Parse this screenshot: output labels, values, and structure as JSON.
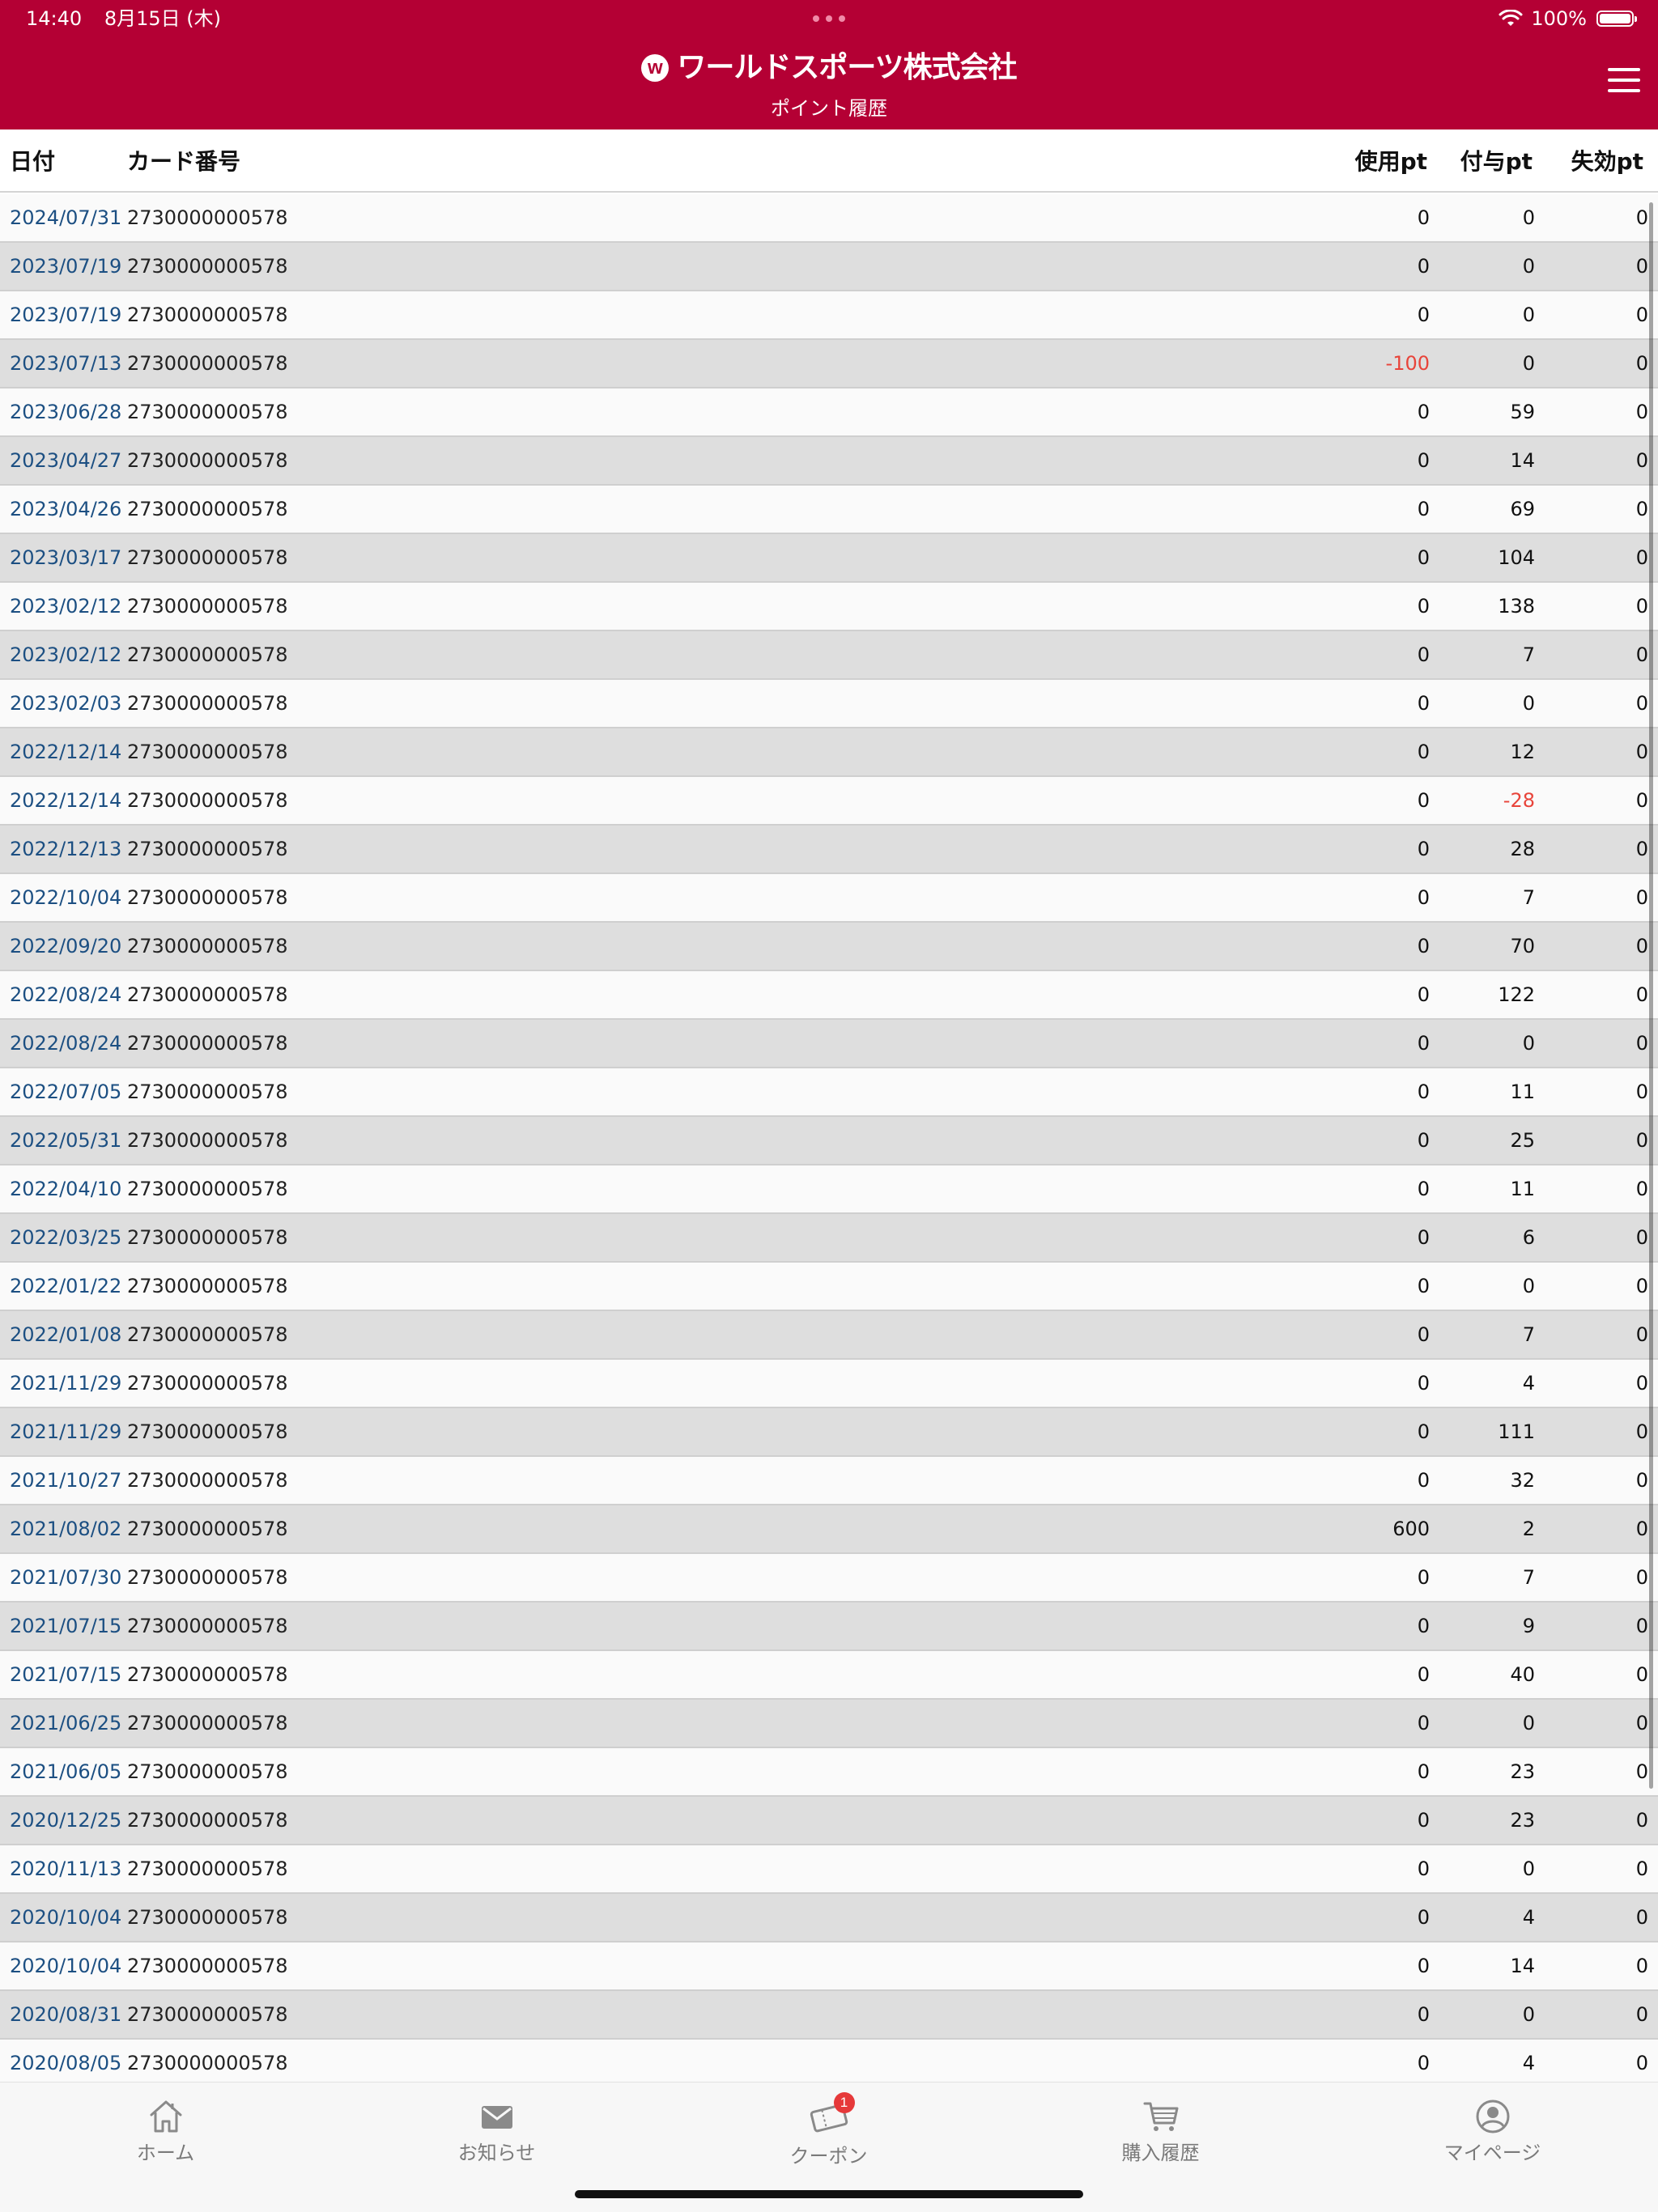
{
  "status_bar": {
    "time": "14:40",
    "date": "8月15日 (木)",
    "battery": "100%"
  },
  "header": {
    "brand_mark": "w",
    "brand_name": "ワールドスポーツ株式会社",
    "page_title": "ポイント履歴"
  },
  "table": {
    "columns": {
      "date": "日付",
      "card": "カード番号",
      "used": "使用pt",
      "given": "付与pt",
      "expired": "失効pt"
    },
    "rows": [
      {
        "date": "2024/07/31",
        "card": "2730000000578",
        "used": "0",
        "given": "0",
        "expired": "0"
      },
      {
        "date": "2023/07/19",
        "card": "2730000000578",
        "used": "0",
        "given": "0",
        "expired": "0"
      },
      {
        "date": "2023/07/19",
        "card": "2730000000578",
        "used": "0",
        "given": "0",
        "expired": "0"
      },
      {
        "date": "2023/07/13",
        "card": "2730000000578",
        "used": "-100",
        "given": "0",
        "expired": "0"
      },
      {
        "date": "2023/06/28",
        "card": "2730000000578",
        "used": "0",
        "given": "59",
        "expired": "0"
      },
      {
        "date": "2023/04/27",
        "card": "2730000000578",
        "used": "0",
        "given": "14",
        "expired": "0"
      },
      {
        "date": "2023/04/26",
        "card": "2730000000578",
        "used": "0",
        "given": "69",
        "expired": "0"
      },
      {
        "date": "2023/03/17",
        "card": "2730000000578",
        "used": "0",
        "given": "104",
        "expired": "0"
      },
      {
        "date": "2023/02/12",
        "card": "2730000000578",
        "used": "0",
        "given": "138",
        "expired": "0"
      },
      {
        "date": "2023/02/12",
        "card": "2730000000578",
        "used": "0",
        "given": "7",
        "expired": "0"
      },
      {
        "date": "2023/02/03",
        "card": "2730000000578",
        "used": "0",
        "given": "0",
        "expired": "0"
      },
      {
        "date": "2022/12/14",
        "card": "2730000000578",
        "used": "0",
        "given": "12",
        "expired": "0"
      },
      {
        "date": "2022/12/14",
        "card": "2730000000578",
        "used": "0",
        "given": "-28",
        "expired": "0"
      },
      {
        "date": "2022/12/13",
        "card": "2730000000578",
        "used": "0",
        "given": "28",
        "expired": "0"
      },
      {
        "date": "2022/10/04",
        "card": "2730000000578",
        "used": "0",
        "given": "7",
        "expired": "0"
      },
      {
        "date": "2022/09/20",
        "card": "2730000000578",
        "used": "0",
        "given": "70",
        "expired": "0"
      },
      {
        "date": "2022/08/24",
        "card": "2730000000578",
        "used": "0",
        "given": "122",
        "expired": "0"
      },
      {
        "date": "2022/08/24",
        "card": "2730000000578",
        "used": "0",
        "given": "0",
        "expired": "0"
      },
      {
        "date": "2022/07/05",
        "card": "2730000000578",
        "used": "0",
        "given": "11",
        "expired": "0"
      },
      {
        "date": "2022/05/31",
        "card": "2730000000578",
        "used": "0",
        "given": "25",
        "expired": "0"
      },
      {
        "date": "2022/04/10",
        "card": "2730000000578",
        "used": "0",
        "given": "11",
        "expired": "0"
      },
      {
        "date": "2022/03/25",
        "card": "2730000000578",
        "used": "0",
        "given": "6",
        "expired": "0"
      },
      {
        "date": "2022/01/22",
        "card": "2730000000578",
        "used": "0",
        "given": "0",
        "expired": "0"
      },
      {
        "date": "2022/01/08",
        "card": "2730000000578",
        "used": "0",
        "given": "7",
        "expired": "0"
      },
      {
        "date": "2021/11/29",
        "card": "2730000000578",
        "used": "0",
        "given": "4",
        "expired": "0"
      },
      {
        "date": "2021/11/29",
        "card": "2730000000578",
        "used": "0",
        "given": "111",
        "expired": "0"
      },
      {
        "date": "2021/10/27",
        "card": "2730000000578",
        "used": "0",
        "given": "32",
        "expired": "0"
      },
      {
        "date": "2021/08/02",
        "card": "2730000000578",
        "used": "600",
        "given": "2",
        "expired": "0"
      },
      {
        "date": "2021/07/30",
        "card": "2730000000578",
        "used": "0",
        "given": "7",
        "expired": "0"
      },
      {
        "date": "2021/07/15",
        "card": "2730000000578",
        "used": "0",
        "given": "9",
        "expired": "0"
      },
      {
        "date": "2021/07/15",
        "card": "2730000000578",
        "used": "0",
        "given": "40",
        "expired": "0"
      },
      {
        "date": "2021/06/25",
        "card": "2730000000578",
        "used": "0",
        "given": "0",
        "expired": "0"
      },
      {
        "date": "2021/06/05",
        "card": "2730000000578",
        "used": "0",
        "given": "23",
        "expired": "0"
      },
      {
        "date": "2020/12/25",
        "card": "2730000000578",
        "used": "0",
        "given": "23",
        "expired": "0"
      },
      {
        "date": "2020/11/13",
        "card": "2730000000578",
        "used": "0",
        "given": "0",
        "expired": "0"
      },
      {
        "date": "2020/10/04",
        "card": "2730000000578",
        "used": "0",
        "given": "4",
        "expired": "0"
      },
      {
        "date": "2020/10/04",
        "card": "2730000000578",
        "used": "0",
        "given": "14",
        "expired": "0"
      },
      {
        "date": "2020/08/31",
        "card": "2730000000578",
        "used": "0",
        "given": "0",
        "expired": "0"
      },
      {
        "date": "2020/08/05",
        "card": "2730000000578",
        "used": "0",
        "given": "4",
        "expired": "0"
      }
    ]
  },
  "tabbar": {
    "items": [
      {
        "label": "ホーム",
        "icon": "home-icon"
      },
      {
        "label": "お知らせ",
        "icon": "mail-icon"
      },
      {
        "label": "クーポン",
        "icon": "coupon-icon",
        "badge": "1"
      },
      {
        "label": "購入履歴",
        "icon": "cart-icon"
      },
      {
        "label": "マイページ",
        "icon": "user-circle-icon"
      }
    ]
  },
  "colors": {
    "header_bg": "#b40034",
    "date_link": "#1c4f82",
    "negative": "#e8443a",
    "badge": "#e6393a"
  }
}
